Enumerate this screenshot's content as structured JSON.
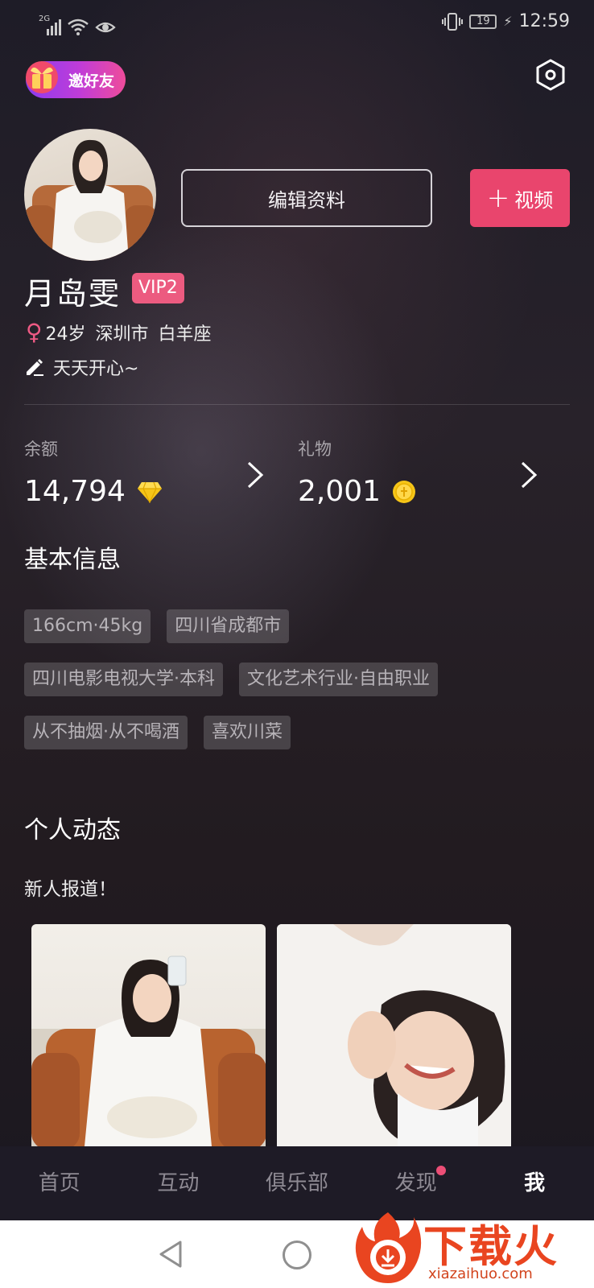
{
  "status_bar": {
    "network": "2G",
    "battery": "19",
    "time": "12:59"
  },
  "header": {
    "invite_label": "邀好友"
  },
  "profile": {
    "edit_label": "编辑资料",
    "video_label": "视频",
    "name": "月岛雯",
    "vip": "VIP2",
    "age": "24岁",
    "city": "深圳市",
    "zodiac": "白羊座",
    "signature": "天天开心~"
  },
  "wallet": {
    "balance_label": "余额",
    "balance_value": "14,794",
    "gift_label": "礼物",
    "gift_value": "2,001"
  },
  "basic_info": {
    "title": "基本信息",
    "tags": [
      "166cm·45kg",
      "四川省成都市",
      "四川电影电视大学·本科",
      "文化艺术行业·自由职业",
      "从不抽烟·从不喝酒",
      "喜欢川菜"
    ]
  },
  "moments": {
    "title": "个人动态",
    "post_text": "新人报道！"
  },
  "tabs": [
    "首页",
    "互动",
    "俱乐部",
    "发现",
    "我"
  ],
  "watermark": {
    "brand": "下载火",
    "url": "xiazaihuo.com"
  },
  "colors": {
    "accent": "#e9456d",
    "vip": "#ec5b80",
    "background": "#1d1a21"
  }
}
